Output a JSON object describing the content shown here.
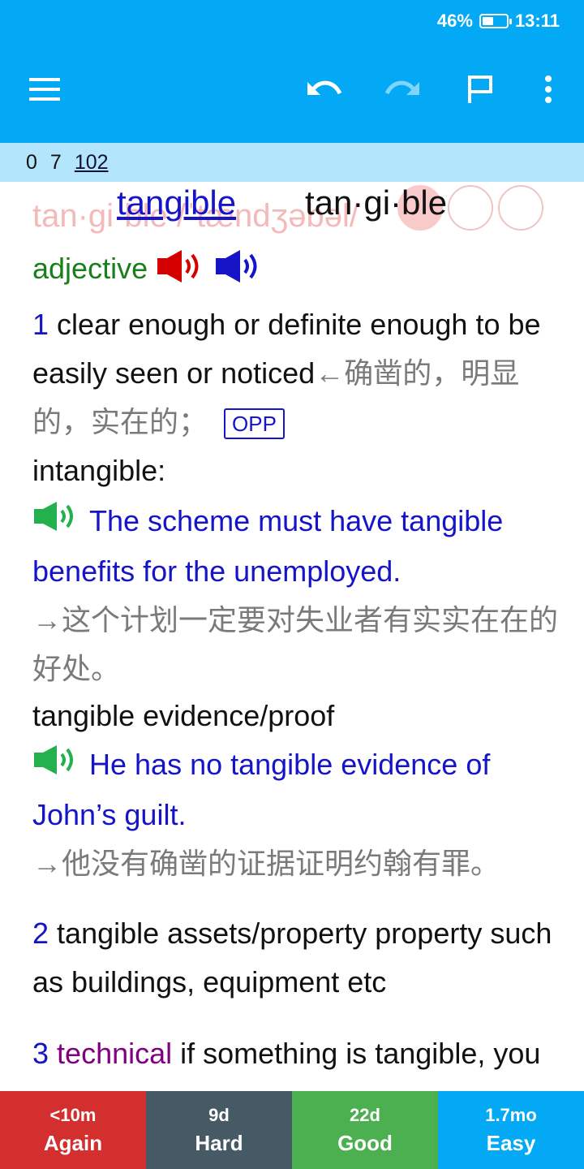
{
  "status": {
    "battery_percent": "46%",
    "time": "13:11",
    "battery_level": 0.46
  },
  "toolbar": {
    "icons": [
      "menu-icon",
      "undo-icon",
      "redo-icon",
      "flag-icon",
      "more-vert-icon"
    ],
    "redo_enabled": false
  },
  "counts": {
    "new": "0",
    "learning": "7",
    "review": "102"
  },
  "card": {
    "ghost_text": "tan·gi·ble /ˈtændʒəbəl/",
    "headword": "tangible",
    "syllables": "tan·gi·ble",
    "pos": "adjective",
    "sense1": {
      "number": "1",
      "definition": "clear enough or definite enough to be easily seen or noticed",
      "translation": "←确凿的，明显的，实在的；",
      "opp_label": "OPP",
      "opp_word": " intangible:",
      "example1": "The scheme must have tangible benefits for the unemployed.",
      "example1_cn": "→这个计划一定要对失业者有实实在在的好处。",
      "collocation": "tangible evidence/proof",
      "example2": "He has no tangible evidence of John’s guilt.",
      "example2_cn": "→他没有确凿的证据证明约翰有罪。"
    },
    "sense2": {
      "number": "2",
      "definition": "tangible assets/property property such as buildings, equipment etc"
    },
    "sense3": {
      "number": "3",
      "label": "technical",
      "definition": " if something is tangible, you can touch it"
    }
  },
  "answers": [
    {
      "time": "<10m",
      "label": "Again",
      "color": "#d32f2f"
    },
    {
      "time": "9d",
      "label": "Hard",
      "color": "#455a64"
    },
    {
      "time": "22d",
      "label": "Good",
      "color": "#4caf50"
    },
    {
      "time": "1.7mo",
      "label": "Easy",
      "color": "#03a9f4"
    }
  ]
}
